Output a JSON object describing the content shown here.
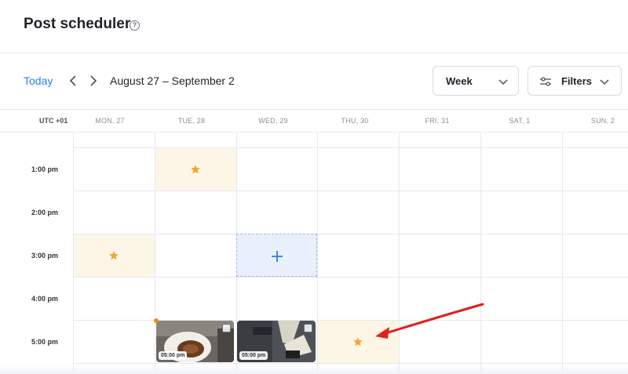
{
  "header": {
    "title": "Post scheduler",
    "help_icon": "question-circle-icon",
    "help_glyph": "?"
  },
  "toolbar": {
    "today_label": "Today",
    "prev_icon": "chevron-left-icon",
    "next_icon": "chevron-right-icon",
    "date_range": "August 27 – September 2",
    "view_select": {
      "value": "Week",
      "icon": "chevron-down-icon"
    },
    "filters": {
      "label": "Filters",
      "icon": "sliders-icon",
      "chevron_icon": "chevron-down-icon"
    }
  },
  "calendar": {
    "timezone": "UTC +01",
    "days": [
      "MON, 27",
      "TUE, 28",
      "WED, 29",
      "THU, 30",
      "FRI, 31",
      "SAT, 1",
      "SUN, 2"
    ],
    "times": [
      "1:00 pm",
      "2:00 pm",
      "3:00 pm",
      "4:00 pm",
      "5:00 pm"
    ],
    "suggested_slots": [
      {
        "day": "TUE, 28",
        "time": "1:00 pm",
        "icon": "star-icon"
      },
      {
        "day": "MON, 27",
        "time": "3:00 pm",
        "icon": "star-icon"
      },
      {
        "day": "THU, 30",
        "time": "5:00 pm",
        "icon": "star-icon"
      }
    ],
    "new_post_slot": {
      "day": "WED, 29",
      "time": "3:00 pm",
      "icon": "plus-icon"
    },
    "posts": [
      {
        "day": "TUE, 28",
        "time_label": "05:00 pm",
        "badge_icon": "image-icon",
        "status_dot_color": "#f28b1d"
      },
      {
        "day": "WED, 29",
        "time_label": "05:00 pm",
        "badge_icon": "image-icon"
      }
    ]
  },
  "annotation": {
    "icon": "red-arrow-icon",
    "color": "#e0201e"
  },
  "colors": {
    "accent": "#2b7de9",
    "suggested_bg": "#fdf6e7",
    "star": "#f0a830",
    "new_slot_bg": "#e8f0fc"
  }
}
